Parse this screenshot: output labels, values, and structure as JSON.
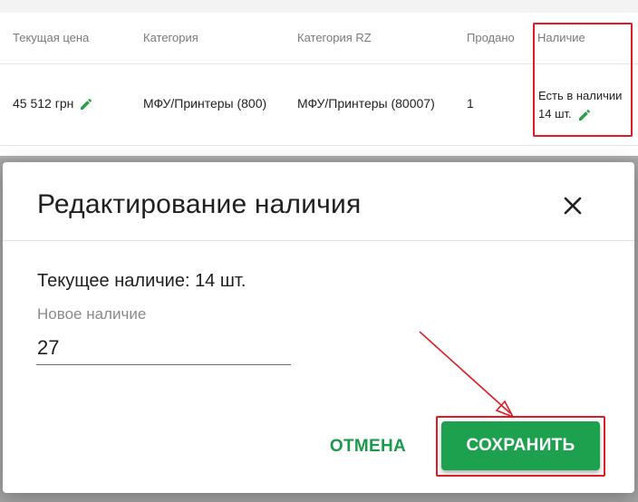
{
  "table": {
    "headers": {
      "price": "Текущая цена",
      "category": "Категория",
      "category_rz": "Категория RZ",
      "sold": "Продано",
      "availability": "Наличие"
    },
    "row": {
      "price": "45 512 грн",
      "category": "МФУ/Принтеры (800)",
      "category_rz": "МФУ/Принтеры (80007)",
      "sold": "1",
      "availability_line1": "Есть в наличии",
      "availability_line2": "14 шт."
    }
  },
  "dialog": {
    "title": "Редактирование наличия",
    "current_stock": "Текущее наличие: 14 шт.",
    "field_label": "Новое наличие",
    "field_value": "27",
    "cancel_label": "ОТМЕНА",
    "save_label": "СОХРАНИТЬ"
  },
  "icons": {
    "edit": "pencil-icon",
    "close": "close-icon"
  },
  "colors": {
    "accent_green": "#1ea14f",
    "pencil_green": "#2e9c4b",
    "highlight_red": "#e01b24"
  }
}
